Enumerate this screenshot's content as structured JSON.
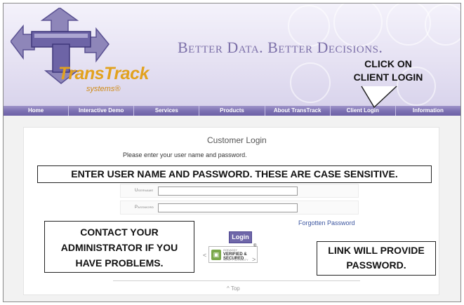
{
  "banner": {
    "logo_name": "TransTrack",
    "logo_sub": "systems®",
    "tagline": "Better Data.  Better Decisions."
  },
  "nav": {
    "items": [
      "Home",
      "Interactive Demo",
      "Services",
      "Products",
      "About TransTrack",
      "Client Login",
      "Information"
    ]
  },
  "login": {
    "title": "Customer Login",
    "intro": "Please enter your user name and password.",
    "username_label": "Username",
    "password_label": "Password",
    "forgot_link": "Forgotten Password",
    "login_button": "Login",
    "top_link": "^ Top"
  },
  "seal": {
    "line1": "GODADDY",
    "line2": "VERIFIED & SECURED",
    "line3": "VERIFY SECURITY",
    "reg": "®",
    "prev": "<",
    "next": ">"
  },
  "callouts": {
    "client_login": "CLICK ON\nCLIENT LOGIN",
    "main": "ENTER USER NAME AND PASSWORD.  THESE ARE CASE SENSITIVE.",
    "admin": "CONTACT YOUR\nADMINISTRATOR IF YOU\nHAVE PROBLEMS.",
    "link": "LINK WILL PROVIDE\nPASSWORD."
  },
  "colors": {
    "brand_purple": "#7d72b3",
    "logo_gold": "#e2a21e",
    "link_blue": "#3b55a0"
  }
}
